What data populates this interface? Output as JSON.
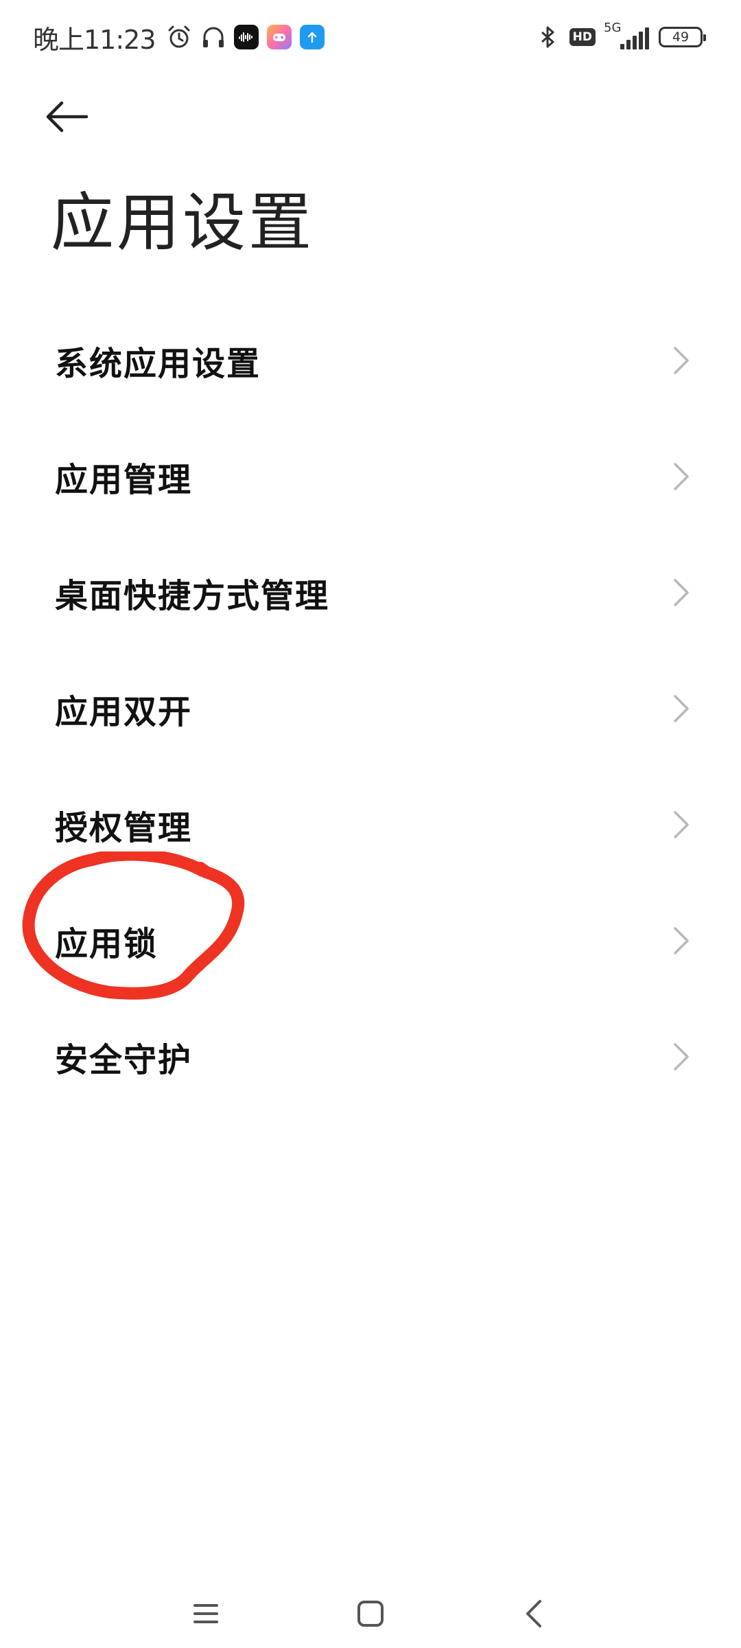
{
  "status_bar": {
    "time": "晚上11:23",
    "network_type": "5G",
    "hd_label": "HD",
    "battery_level": "49",
    "icons": [
      "alarm-icon",
      "headphones-icon",
      "music-app-icon",
      "game-app-icon",
      "upload-app-icon",
      "bluetooth-icon",
      "signal-icon",
      "battery-icon"
    ],
    "colors": {
      "music_app": "#111111",
      "game_app": "#ff7aa8",
      "upload_app": "#1e9bf0"
    }
  },
  "header": {
    "title": "应用设置",
    "back_icon": "arrow-left-icon"
  },
  "settings": {
    "items": [
      {
        "label": "系统应用设置"
      },
      {
        "label": "应用管理"
      },
      {
        "label": "桌面快捷方式管理"
      },
      {
        "label": "应用双开"
      },
      {
        "label": "授权管理"
      },
      {
        "label": "应用锁"
      },
      {
        "label": "安全守护"
      }
    ]
  },
  "annotation": {
    "color": "#ee3322",
    "target": "应用锁"
  },
  "nav_bar": {
    "icons": [
      "menu-icon",
      "home-icon",
      "back-icon"
    ]
  }
}
